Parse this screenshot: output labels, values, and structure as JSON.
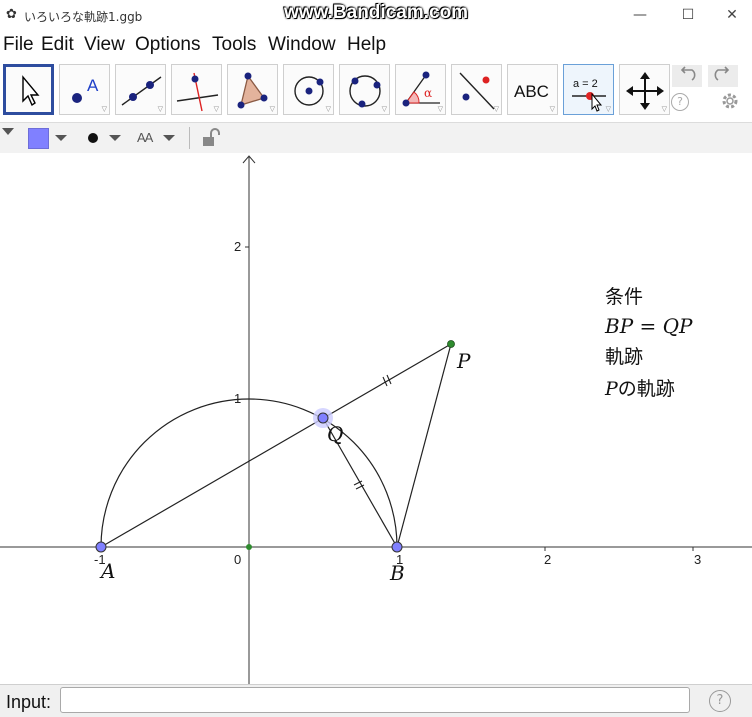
{
  "window": {
    "title": "いろいろな軌跡1.ggb",
    "watermark": "www.Bandicam.com",
    "minimize": "—",
    "maximize": "☐",
    "close": "✕"
  },
  "menu": {
    "items": [
      "File",
      "Edit",
      "View",
      "Options",
      "Tools",
      "Window",
      "Help"
    ]
  },
  "toolbar": {
    "tools": [
      {
        "name": "move-tool",
        "icon": "arrow-cursor-icon",
        "selected": true
      },
      {
        "name": "point-tool",
        "icon": "point-icon",
        "label": "A"
      },
      {
        "name": "line-tool",
        "icon": "line-icon"
      },
      {
        "name": "perpendicular-line-tool",
        "icon": "perpendicular-line-icon"
      },
      {
        "name": "polygon-tool",
        "icon": "polygon-icon"
      },
      {
        "name": "circle-center-point-tool",
        "icon": "circle-center-icon"
      },
      {
        "name": "circle-three-points-tool",
        "icon": "circle-three-points-icon"
      },
      {
        "name": "angle-tool",
        "icon": "angle-icon",
        "label": "α"
      },
      {
        "name": "reflect-tool",
        "icon": "reflect-about-line-icon"
      },
      {
        "name": "text-tool",
        "icon": "text-icon",
        "label": "ABC"
      },
      {
        "name": "slider-tool",
        "icon": "slider-icon",
        "label": "a = 2"
      },
      {
        "name": "move-graphics-view-tool",
        "icon": "move-graphics-icon"
      }
    ],
    "undo_icon": "undo-icon",
    "redo_icon": "redo-icon",
    "help_icon": "help-icon",
    "settings_icon": "gear-icon"
  },
  "stylebar": {
    "color": "#8080ff",
    "text_style_label": "AA"
  },
  "graphics": {
    "x_tick_labels": [
      "-1",
      "0",
      "1",
      "2",
      "3"
    ],
    "y_tick_labels": [
      "1",
      "2"
    ],
    "points": {
      "A": {
        "label": "A"
      },
      "B": {
        "label": "B"
      },
      "Q": {
        "label": "Q"
      },
      "P": {
        "label": "P"
      }
    },
    "text_block": {
      "line1": "条件",
      "line2": "BP = QP",
      "line3": "軌跡",
      "line4_var": "P",
      "line4_rest": "の軌跡"
    },
    "colors": {
      "point_fill": "#8080ff",
      "small_point_fill": "#2e8b2e",
      "highlight": "#ccccff"
    }
  },
  "input_bar": {
    "label": "Input:",
    "value": "",
    "placeholder": "",
    "help": "?"
  }
}
